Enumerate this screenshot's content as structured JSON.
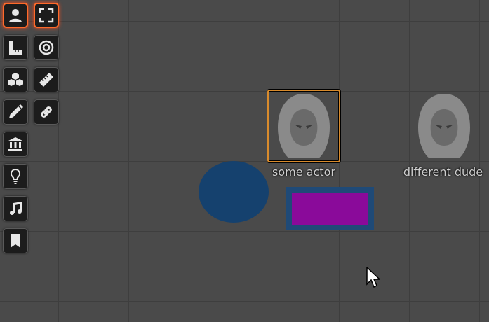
{
  "toolbar": {
    "tools": [
      {
        "icon": "user-icon",
        "active": true
      },
      {
        "icon": "fullscreen-icon",
        "active": true
      },
      {
        "icon": "ruler-square-icon",
        "active": false
      },
      {
        "icon": "target-icon",
        "active": false
      },
      {
        "icon": "cubes-icon",
        "active": false
      },
      {
        "icon": "ruler-icon",
        "active": false
      },
      {
        "icon": "pencil-icon",
        "active": false
      },
      {
        "icon": "link-icon",
        "active": false
      },
      {
        "icon": "bank-icon",
        "active": false
      },
      {
        "icon": "lightbulb-icon",
        "active": false
      },
      {
        "icon": "music-icon",
        "active": false
      },
      {
        "icon": "bookmark-icon",
        "active": false
      }
    ]
  },
  "scene": {
    "tokens": [
      {
        "label": "some actor",
        "selected": true
      },
      {
        "label": "different dude",
        "selected": false
      }
    ],
    "colors": {
      "background": "#4a4a4a",
      "grid": "#3e3e3e",
      "selection": "#d98b2c",
      "ellipse": "#15416e",
      "rect_border": "#1f4a77",
      "rect_fill": "#8a0a9a",
      "active_tool": "#ff6a2a"
    }
  }
}
